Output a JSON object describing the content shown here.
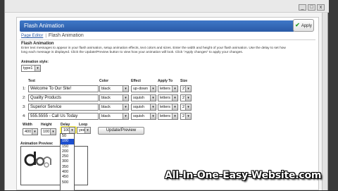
{
  "window": {
    "min": "_",
    "max": "□",
    "close": "x"
  },
  "header": {
    "title": "Flash Animation",
    "apply_label": "Apply"
  },
  "breadcrumb": {
    "parent": "Page Editor",
    "separator": "|",
    "current": "Flash Animation"
  },
  "section": {
    "title": "Flash Animation",
    "description": "Enter text messages to appear in your flash animation, setup animation effects, text colors and sizes. Enter the width and height of your flash animation. Use the delay to set how long each message is displayed. Click the Update/Preview button to view how your animation will look. Click \"Apply changes\" to apply your changes."
  },
  "style": {
    "label": "Animation style:",
    "value": "type1"
  },
  "columns": {
    "text": "Text",
    "color": "Color",
    "effect": "Effect",
    "apply_to": "Apply To",
    "size": "Size"
  },
  "rows": [
    {
      "num": "1:",
      "text": "Welcome To Our Site!",
      "color": "black",
      "effect": "up-down",
      "apply_to": "letters",
      "size": "2"
    },
    {
      "num": "2:",
      "text": "Quality Products",
      "color": "black",
      "effect": "squish",
      "apply_to": "letters",
      "size": "2"
    },
    {
      "num": "3:",
      "text": "Superior Service",
      "color": "black",
      "effect": "squish",
      "apply_to": "letters",
      "size": "2"
    },
    {
      "num": "4:",
      "text": "555.5555 - Call Us Today",
      "color": "black",
      "effect": "squish",
      "apply_to": "letters",
      "size": "2"
    }
  ],
  "settings": {
    "width_label": "Width",
    "width": "400",
    "height_label": "Height",
    "height": "100",
    "delay_label": "Delay",
    "delay": "100",
    "loop_label": "Loop",
    "loop": "yes",
    "update_label": "Update/Preview"
  },
  "preview_label": "Animation Preview:",
  "delay_options": [
    "50",
    "100",
    "150",
    "200",
    "250",
    "300",
    "350",
    "400",
    "450",
    "500"
  ],
  "watermark": "All-In-One-Easy-Website.com",
  "colors": {
    "header": "#2a5aa6",
    "highlight": "#fff35a",
    "selected_option": "#1d4fcf"
  }
}
